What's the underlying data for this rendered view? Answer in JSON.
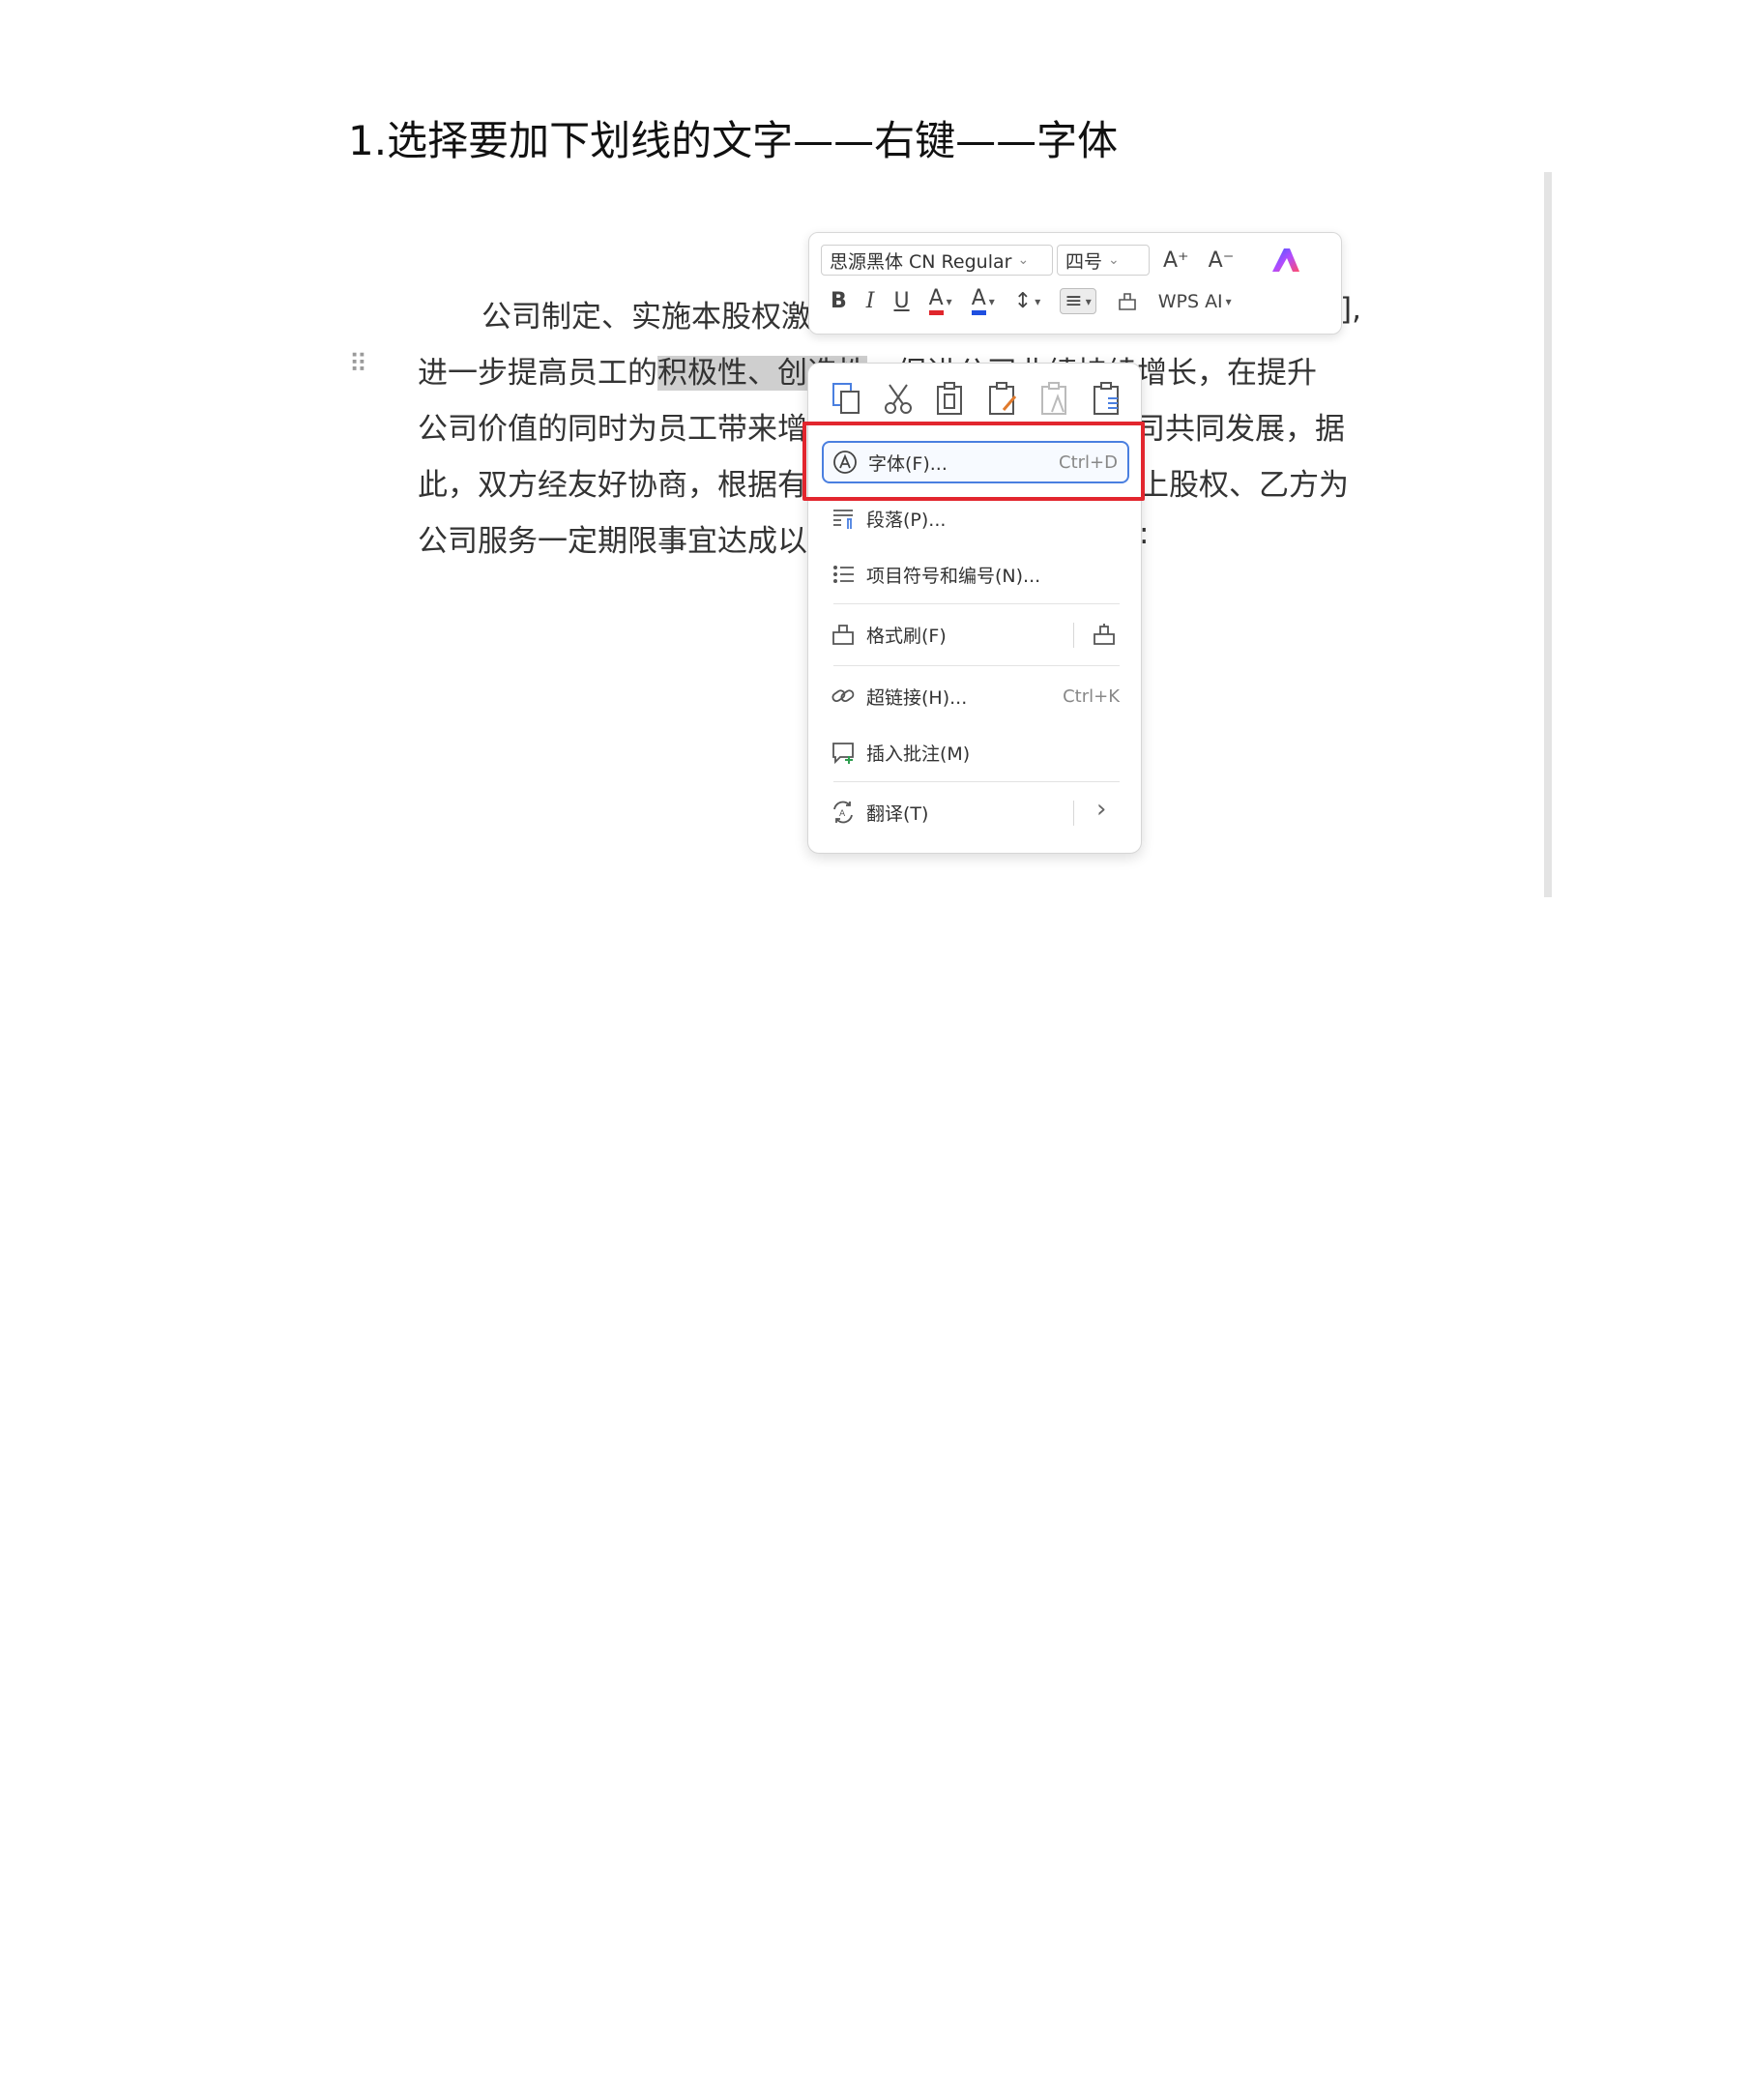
{
  "heading": "1.选择要加下划线的文字——右键——字体",
  "document": {
    "line1_text": "公司制定、实施本股权激",
    "line1_tail": "],",
    "line2_pre": "进一步提高员工的",
    "line2_selected": "积极性、创造性",
    "line2_post": "，促进公司业绩持续增长，在提升",
    "line3_left": "公司价值的同时为员工带来增",
    "line3_right": "司共同发展，据",
    "line4_left": "此，双方经友好协商，根据有",
    "line4_right": "上股权、乙方为",
    "line5_left": "公司服务一定期限事宜达成以",
    "line5_right": ":"
  },
  "mini_toolbar": {
    "font_name": "思源黑体 CN Regular",
    "font_size": "四号",
    "grow_font": "A⁺",
    "shrink_font": "A⁻",
    "bold": "B",
    "italic": "I",
    "underline": "U",
    "highlight": "A",
    "font_color": "A",
    "line_spacing": "↕",
    "align": "≡",
    "format_painter": "⌂",
    "wps_ai": "WPS AI",
    "colors": {
      "highlight": "#e0262c",
      "font_color": "#1f4fe0"
    }
  },
  "context_menu": {
    "quick_icons": [
      "copy-icon",
      "cut-icon",
      "paste-icon",
      "paste-format-icon",
      "paste-text-icon",
      "paste-special-icon"
    ],
    "font": {
      "label": "字体(F)...",
      "shortcut": "Ctrl+D"
    },
    "paragraph": {
      "label": "段落(P)..."
    },
    "bullets": {
      "label": "项目符号和编号(N)..."
    },
    "format_painter": {
      "label": "格式刷(F)"
    },
    "hyperlink": {
      "label": "超链接(H)...",
      "shortcut": "Ctrl+K"
    },
    "comment": {
      "label": "插入批注(M)"
    },
    "translate": {
      "label": "翻译(T)",
      "arrow": "›"
    }
  },
  "highlight_color": "#e2262e"
}
